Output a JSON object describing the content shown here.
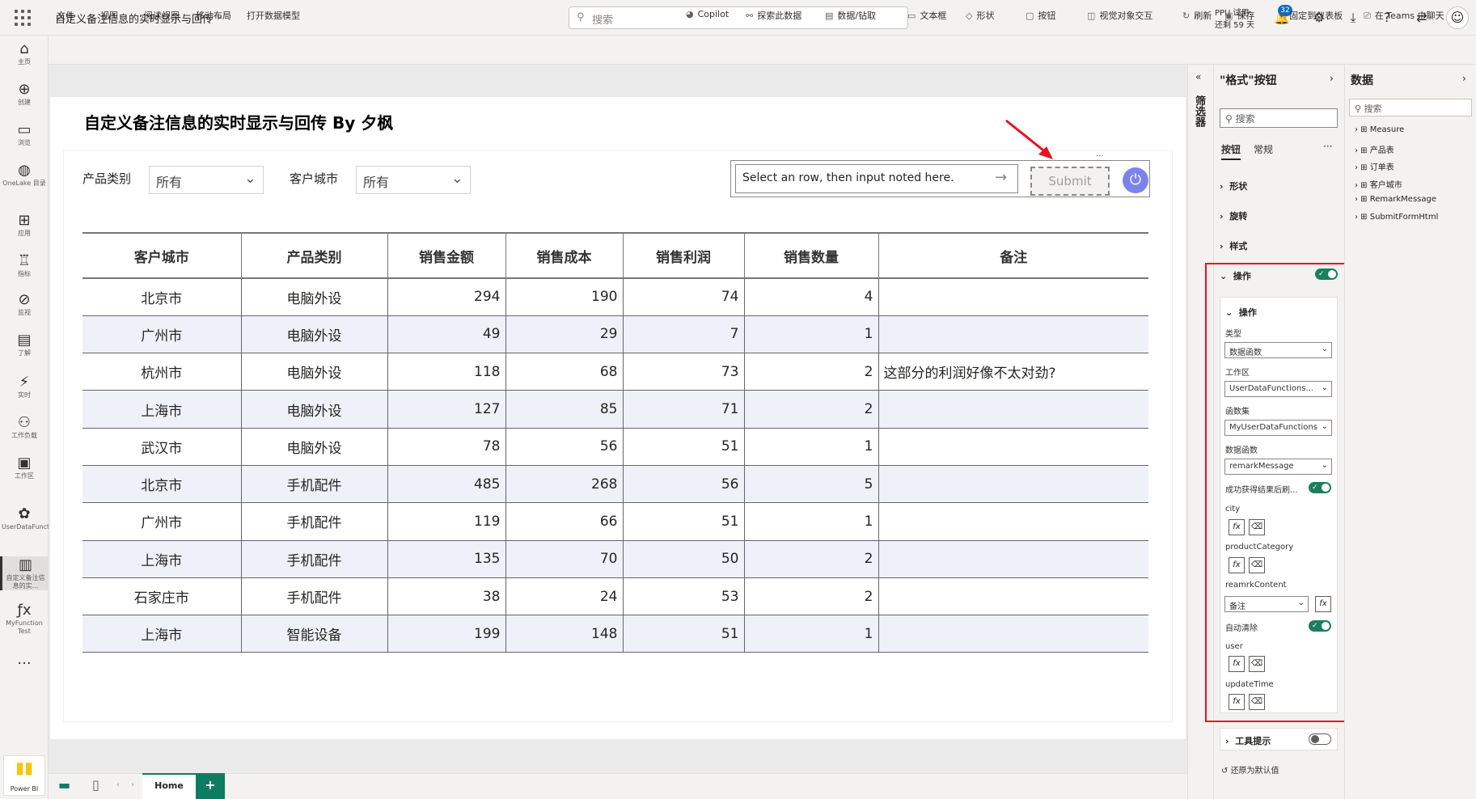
{
  "topbar": {
    "doc_title": "自定义备注信息的实时显示与回传",
    "search_placeholder": "搜索",
    "ppu_line1": "PPU 试用:",
    "ppu_line2": "还剩 59 天",
    "notif_count": "32"
  },
  "leftnav": [
    {
      "icon": "⌂",
      "label": "主页"
    },
    {
      "icon": "⊕",
      "label": "创建"
    },
    {
      "icon": "▭",
      "label": "浏览"
    },
    {
      "icon": "◍",
      "label": "OneLake 目录"
    },
    {
      "icon": "⊞",
      "label": "应用"
    },
    {
      "icon": "♖",
      "label": "指标"
    },
    {
      "icon": "⊘",
      "label": "监视"
    },
    {
      "icon": "▤",
      "label": "了解"
    },
    {
      "icon": "⚡",
      "label": "实时"
    },
    {
      "icon": "⚇",
      "label": "工作负载"
    },
    {
      "icon": "▣",
      "label": "工作区"
    },
    {
      "icon": "✿",
      "label": "UserDataFunctionsWo..."
    },
    {
      "icon": "▥",
      "label": "自定义备注信息的实..."
    },
    {
      "icon": "ƒx",
      "label": "MyFunction Test"
    },
    {
      "icon": "···",
      "label": ""
    }
  ],
  "powerbi_label": "Power BI",
  "ribbon": {
    "left": [
      "文件",
      "视图",
      "阅读视图",
      "移动布局",
      "打开数据模型"
    ],
    "right": [
      "Copilot",
      "探索此数据",
      "数据/钻取",
      "文本框",
      "形状",
      "按钮",
      "视觉对象交互",
      "刷新",
      "保存",
      "固定到仪表板",
      "在 Teams 中聊天"
    ]
  },
  "report": {
    "title": "自定义备注信息的实时显示与回传 By 夕枫",
    "slicer1_label": "产品类别",
    "slicer1_value": "所有",
    "slicer2_label": "客户城市",
    "slicer2_value": "所有",
    "note_placeholder": "Select an row, then input noted here.",
    "submit_label": "Submit",
    "more": "···"
  },
  "table": {
    "headers": [
      "客户城市",
      "产品类别",
      "销售金额",
      "销售成本",
      "销售利润",
      "销售数量",
      "备注"
    ],
    "rows": [
      [
        "北京市",
        "电脑外设",
        "294",
        "190",
        "74",
        "4",
        ""
      ],
      [
        "广州市",
        "电脑外设",
        "49",
        "29",
        "7",
        "1",
        ""
      ],
      [
        "杭州市",
        "电脑外设",
        "118",
        "68",
        "73",
        "2",
        "这部分的利润好像不太对劲?"
      ],
      [
        "上海市",
        "电脑外设",
        "127",
        "85",
        "71",
        "2",
        ""
      ],
      [
        "武汉市",
        "电脑外设",
        "78",
        "56",
        "51",
        "1",
        ""
      ],
      [
        "北京市",
        "手机配件",
        "485",
        "268",
        "56",
        "5",
        ""
      ],
      [
        "广州市",
        "手机配件",
        "119",
        "66",
        "51",
        "1",
        ""
      ],
      [
        "上海市",
        "手机配件",
        "135",
        "70",
        "50",
        "2",
        ""
      ],
      [
        "石家庄市",
        "手机配件",
        "38",
        "24",
        "53",
        "2",
        ""
      ],
      [
        "上海市",
        "智能设备",
        "199",
        "148",
        "51",
        "1",
        ""
      ]
    ]
  },
  "filter_label": "筛选器",
  "format": {
    "title": "\"格式\"按钮",
    "search": "搜索",
    "tab1": "按钮",
    "tab2": "常规",
    "sec_shape": "形状",
    "sec_rotate": "旋转",
    "sec_style": "样式",
    "sec_action": "操作",
    "sub_action": "操作",
    "type_lbl": "类型",
    "type_val": "数据函数",
    "ws_lbl": "工作区",
    "ws_val": "UserDataFunctions...",
    "fs_lbl": "函数集",
    "fs_val": "MyUserDataFunctions",
    "df_lbl": "数据函数",
    "df_val": "remarkMessage",
    "refresh_lbl": "成功获得结果后刷...",
    "p_city": "city",
    "p_cat": "productCategory",
    "p_content": "reamrkContent",
    "p_content_val": "备注",
    "autoclear_lbl": "自动清除",
    "p_user": "user",
    "p_time": "updateTime",
    "tooltip": "工具提示",
    "reset": "还原为默认值"
  },
  "data_pane": {
    "title": "数据",
    "search": "搜索",
    "items": [
      "Measure",
      "产品表",
      "订单表",
      "客户城市",
      "RemarkMessage",
      "SubmitFormHtml"
    ]
  },
  "bottom": {
    "home_tab": "Home",
    "add": "+"
  }
}
